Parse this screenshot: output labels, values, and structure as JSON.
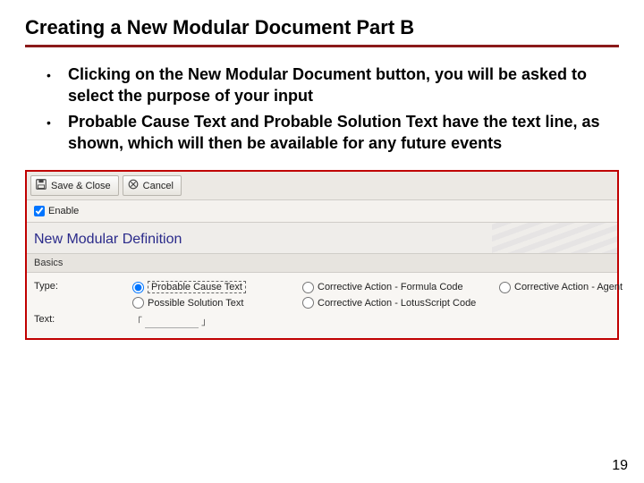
{
  "title": "Creating a New Modular Document Part B",
  "bullets": [
    "Clicking on the New Modular Document button, you will be asked to select the purpose of your input",
    "Probable Cause Text and Probable Solution Text have the text line, as shown, which will then be available for any future events"
  ],
  "toolbar": {
    "save_close": "Save & Close",
    "cancel": "Cancel"
  },
  "enable_label": "Enable",
  "section_title": "New Modular Definition",
  "basics_label": "Basics",
  "form": {
    "type_label": "Type:",
    "text_label": "Text:",
    "text_value": "",
    "radios": {
      "probable_cause": "Probable Cause Text",
      "possible_solution": "Possible Solution Text",
      "corrective_formula": "Corrective Action - Formula Code",
      "corrective_lotus": "Corrective Action - LotusScript Code",
      "corrective_agent": "Corrective Action - Agent"
    }
  },
  "page_number": "19"
}
